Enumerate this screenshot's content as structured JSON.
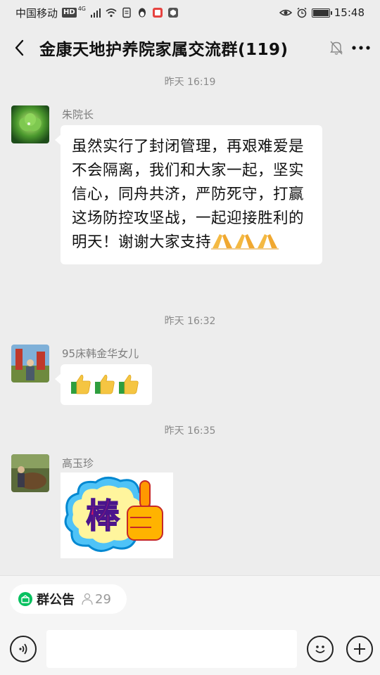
{
  "status_bar": {
    "carrier": "中国移动",
    "hd_badge": "HD",
    "signal_label": "4G",
    "time": "15:48"
  },
  "header": {
    "title": "金康天地护养院家属交流群(119)"
  },
  "messages": [
    {
      "timestamp": "昨天 16:19",
      "sender": "朱院长",
      "text": "虽然实行了封闭管理，再艰难爱是不会隔离，我们和大家一起，坚实信心，同舟共济，严防死守，打赢这场防控攻坚战，一起迎接胜利的明天！谢谢大家支持",
      "trailing_emoji": "pray-icon x3"
    },
    {
      "timestamp": "昨天 16:32",
      "sender": "95床韩金华女儿",
      "content": "thumbs-up-icon x3"
    },
    {
      "timestamp": "昨天 16:35",
      "sender": "高玉珍",
      "sticker_text": "棒"
    }
  ],
  "bottom": {
    "notice_label": "群公告",
    "member_count": "29"
  },
  "colors": {
    "background": "#ededed",
    "bubble": "#ffffff",
    "notice_green": "#07c160"
  }
}
